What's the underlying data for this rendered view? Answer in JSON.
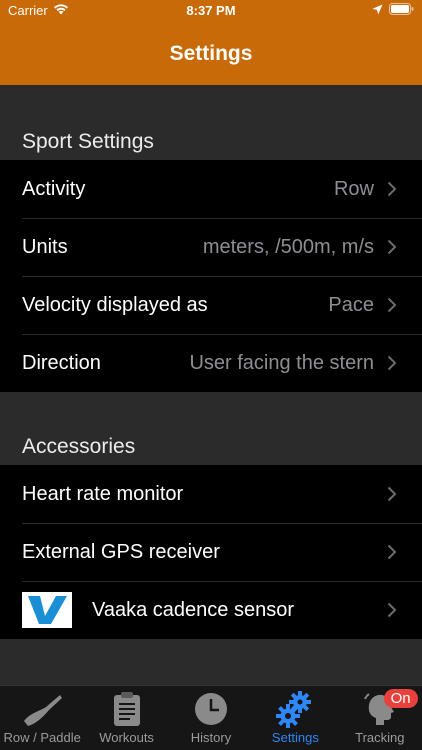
{
  "status_bar": {
    "carrier": "Carrier",
    "time": "8:37 PM"
  },
  "nav": {
    "title": "Settings"
  },
  "sections": {
    "sport": {
      "header": "Sport Settings",
      "rows": [
        {
          "label": "Activity",
          "value": "Row"
        },
        {
          "label": "Units",
          "value": "meters, /500m, m/s"
        },
        {
          "label": "Velocity displayed as",
          "value": "Pace"
        },
        {
          "label": "Direction",
          "value": "User facing the stern"
        }
      ]
    },
    "accessories": {
      "header": "Accessories",
      "rows": [
        {
          "label": "Heart rate monitor"
        },
        {
          "label": "External GPS receiver"
        },
        {
          "label": "Vaaka cadence sensor",
          "icon": "vaaka-logo-icon"
        }
      ]
    }
  },
  "tab_bar": {
    "tabs": [
      {
        "label": "Row / Paddle",
        "icon": "oar-icon"
      },
      {
        "label": "Workouts",
        "icon": "clipboard-icon"
      },
      {
        "label": "History",
        "icon": "clock-icon"
      },
      {
        "label": "Settings",
        "icon": "gears-icon",
        "active": true
      },
      {
        "label": "Tracking",
        "icon": "tracking-head-icon",
        "badge": "On"
      }
    ]
  },
  "colors": {
    "accent": "#c86a08",
    "active_tab": "#2f86f6",
    "badge": "#e8413b",
    "value_text": "#8e8e93"
  }
}
